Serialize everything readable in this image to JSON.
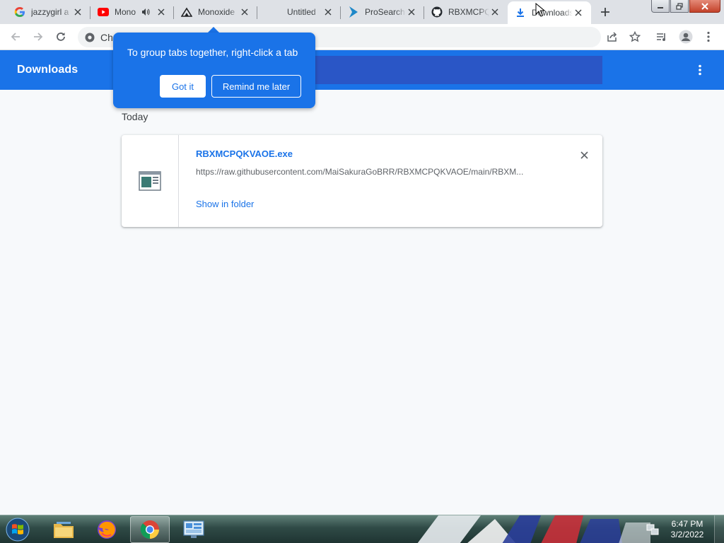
{
  "tabs": [
    {
      "title": "jazzygirl a",
      "icon": "google-icon"
    },
    {
      "title": "Mono",
      "icon": "youtube-icon",
      "audio": true
    },
    {
      "title": "Monoxide",
      "icon": "monoxide-icon"
    },
    {
      "title": "Untitled",
      "icon": "blank-icon"
    },
    {
      "title": "ProSearch",
      "icon": "prosearch-icon"
    },
    {
      "title": "RBXMCPQ",
      "icon": "github-icon"
    },
    {
      "title": "Downloads",
      "icon": "download-icon",
      "active": true
    }
  ],
  "toolbar": {
    "url_text": "Chrome"
  },
  "downloads": {
    "title": "Downloads",
    "date_header": "Today",
    "file_name": "RBXMCPQKVAOE.exe",
    "file_url": "https://raw.githubusercontent.com/MaiSakuraGoBRR/RBXMCPQKVAOE/main/RBXM...",
    "show_in_folder": "Show in folder"
  },
  "iph": {
    "text": "To group tabs together, right-click a tab",
    "got_it": "Got it",
    "remind_later": "Remind me later"
  },
  "taskbar": {
    "time": "6:47 PM",
    "date": "3/2/2022",
    "apps": [
      "explorer-icon",
      "firefox-icon",
      "chrome-icon",
      "control-panel-icon"
    ]
  },
  "colors": {
    "accent": "#1a73e8",
    "search_bg": "#2a56c6",
    "tabstrip": "#dee1e6"
  }
}
